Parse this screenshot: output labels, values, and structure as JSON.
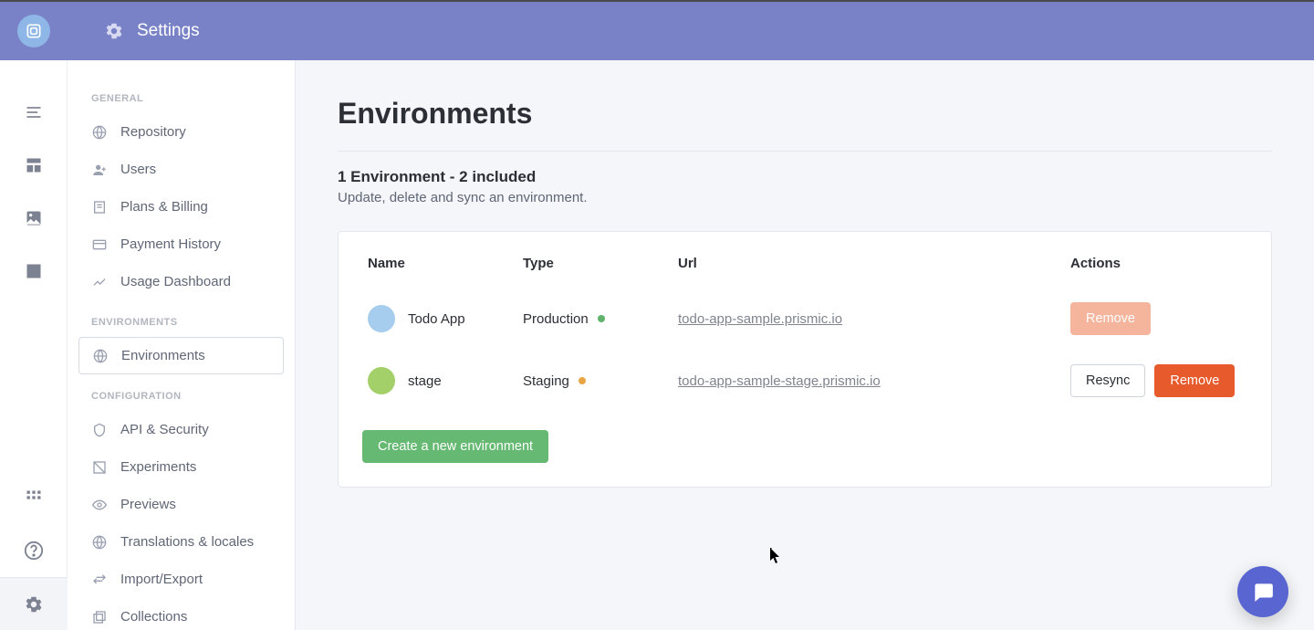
{
  "header": {
    "title": "Settings"
  },
  "sidebar": {
    "group_general": "GENERAL",
    "group_environments": "ENVIRONMENTS",
    "group_configuration": "CONFIGURATION",
    "items": {
      "repository": "Repository",
      "users": "Users",
      "plans": "Plans & Billing",
      "payment": "Payment History",
      "usage": "Usage Dashboard",
      "environments": "Environments",
      "api": "API & Security",
      "experiments": "Experiments",
      "previews": "Previews",
      "translations": "Translations & locales",
      "importexport": "Import/Export",
      "collections": "Collections"
    }
  },
  "main": {
    "title": "Environments",
    "count_line": "1  Environment - 2 included",
    "desc_line": "Update, delete and sync an environment.",
    "columns": {
      "name": "Name",
      "type": "Type",
      "url": "Url",
      "actions": "Actions"
    },
    "rows": [
      {
        "name": "Todo App",
        "type": "Production",
        "url": "todo-app-sample.prismic.io",
        "resync": "",
        "remove": "Remove",
        "remove_disabled": true,
        "bubble": "blue",
        "dot": "g"
      },
      {
        "name": "stage",
        "type": "Staging",
        "url": "todo-app-sample-stage.prismic.io",
        "resync": "Resync",
        "remove": "Remove",
        "remove_disabled": false,
        "bubble": "green",
        "dot": "o"
      }
    ],
    "create_btn": "Create a new environment"
  }
}
